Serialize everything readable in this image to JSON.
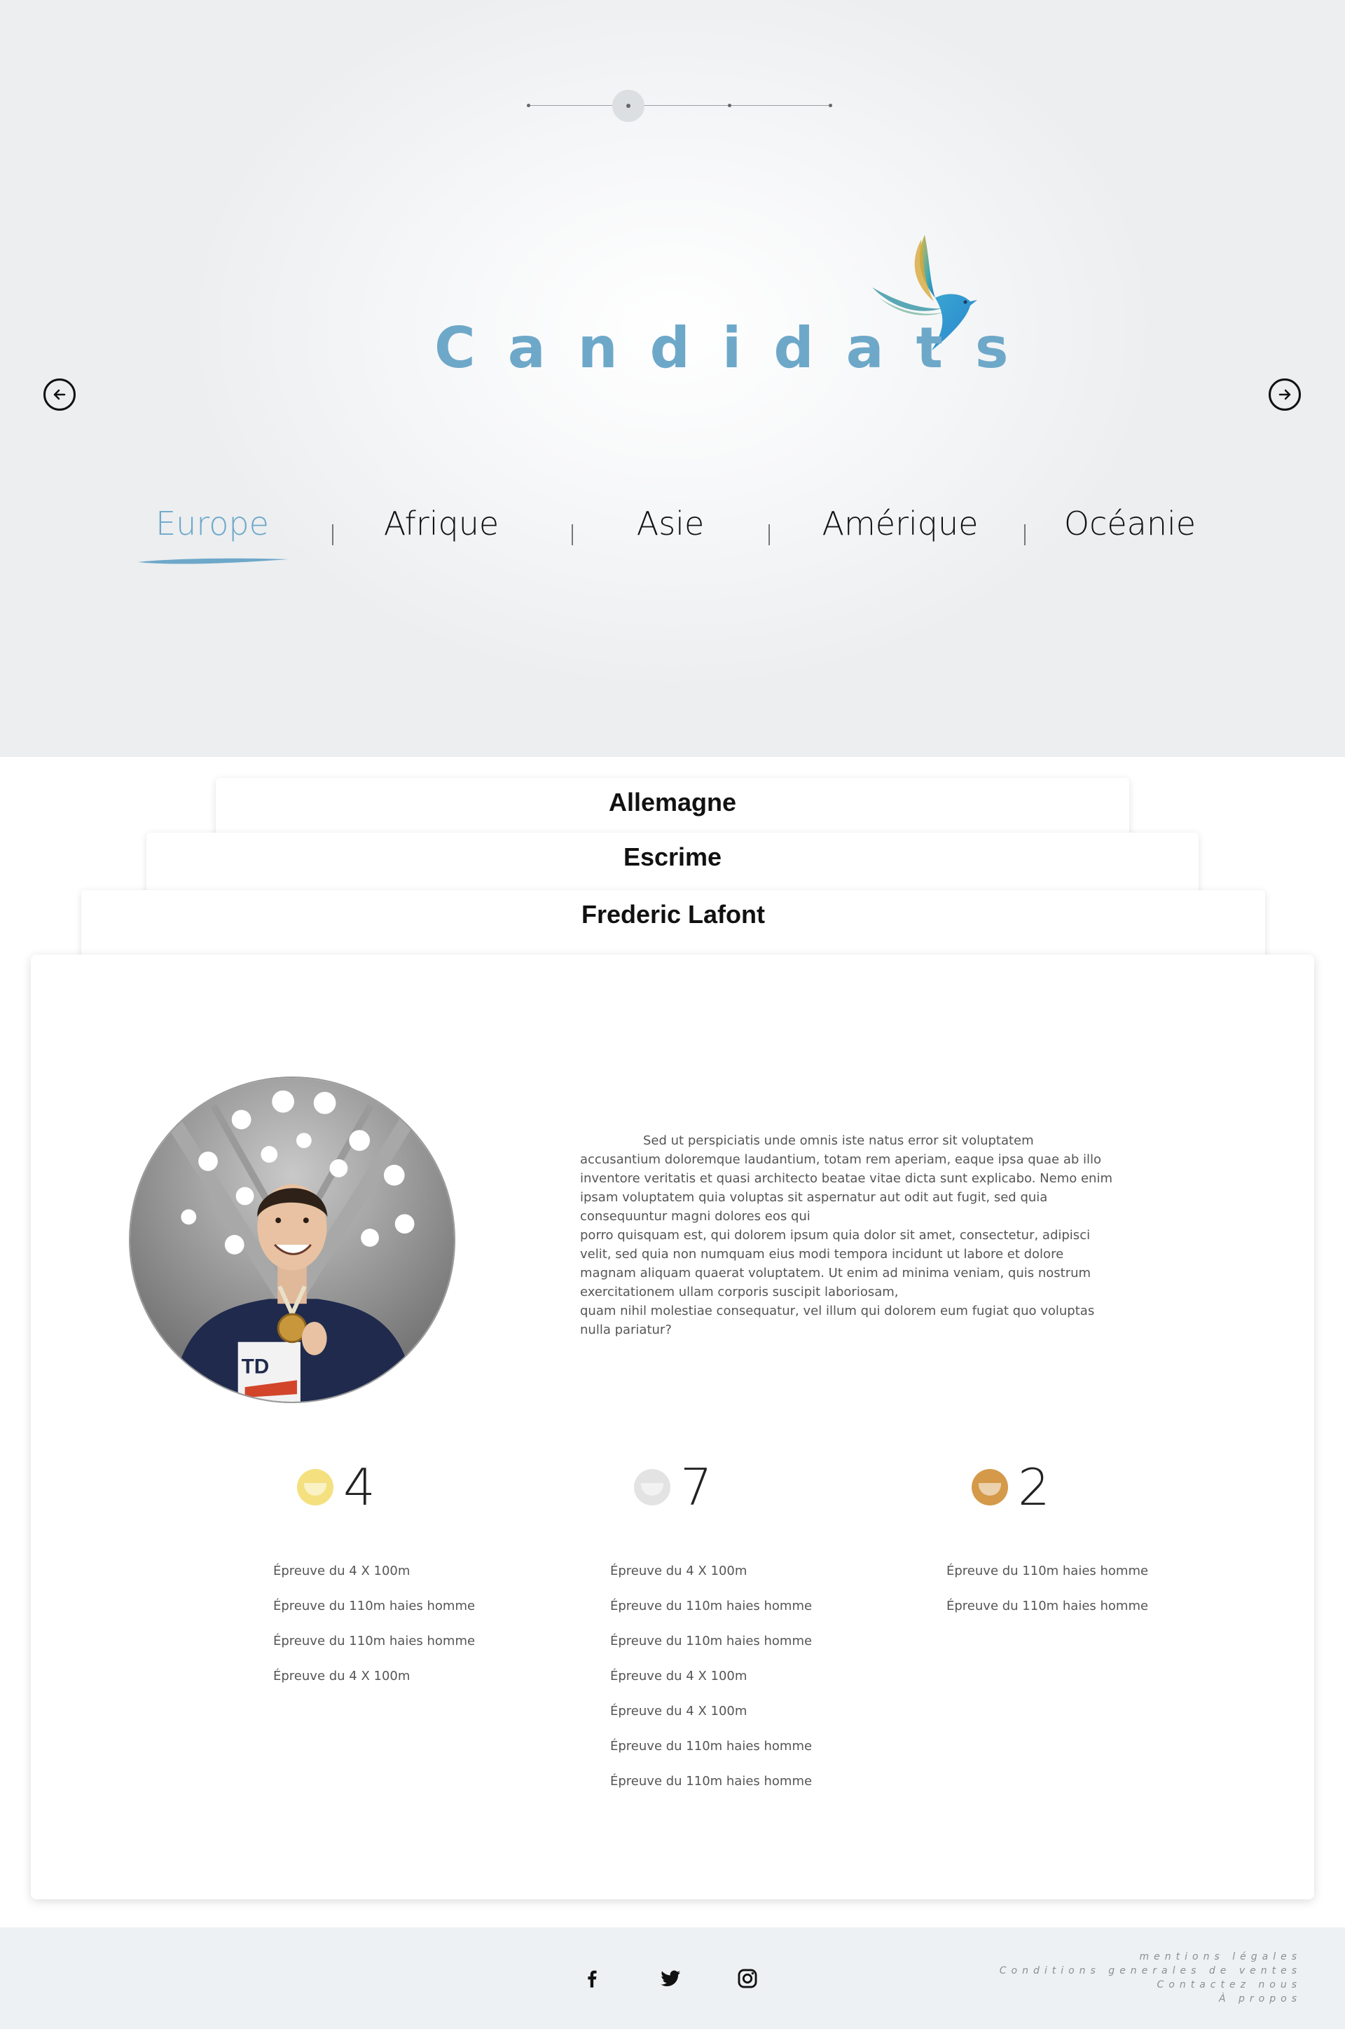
{
  "hero": {
    "title": "Candidats",
    "stepper": {
      "steps": 4,
      "active_step": 2
    },
    "regions": [
      {
        "label": "Europe",
        "active": true
      },
      {
        "label": "Afrique",
        "active": false
      },
      {
        "label": "Asie",
        "active": false
      },
      {
        "label": "Amérique",
        "active": false
      },
      {
        "label": "Océanie",
        "active": false
      }
    ],
    "icons": {
      "prev": "arrow-left-circle-icon",
      "next": "arrow-right-circle-icon",
      "logo": "hummingbird-logo"
    },
    "accent_color": "#6ea8c9"
  },
  "cards": {
    "country": "Allemagne",
    "sport": "Escrime",
    "athlete": "Frederic Lafont"
  },
  "profile": {
    "bio": [
      "Sed ut perspiciatis unde omnis iste natus error sit voluptatem accusantium doloremque laudantium, totam rem aperiam, eaque ipsa quae ab illo inventore veritatis et quasi architecto beatae vitae dicta sunt explicabo. Nemo enim ipsam voluptatem quia voluptas sit aspernatur aut odit aut fugit, sed quia consequuntur magni dolores eos qui",
      "porro quisquam est, qui dolorem ipsum quia dolor sit amet, consectetur, adipisci velit, sed quia non numquam eius modi tempora incidunt ut labore et dolore magnam aliquam quaerat voluptatem. Ut enim ad minima veniam, quis nostrum exercitationem ullam corporis suscipit laboriosam,",
      "quam nihil molestiae consequatur, vel illum qui dolorem eum fugiat quo voluptas nulla pariatur?"
    ]
  },
  "medals": {
    "gold": {
      "count": "4",
      "color": "#f4e07f",
      "events": [
        "Épreuve du 4 X 100m",
        "Épreuve du 110m haies homme",
        "Épreuve du 110m haies homme",
        "Épreuve du 4 X 100m"
      ]
    },
    "silver": {
      "count": "7",
      "color": "#e3e3e3",
      "events": [
        "Épreuve du 4 X 100m",
        "Épreuve du 110m haies homme",
        "Épreuve du 110m haies homme",
        "Épreuve du 4 X 100m",
        "Épreuve du 4 X 100m",
        "Épreuve du 110m haies homme",
        "Épreuve du 110m haies homme"
      ]
    },
    "bronze": {
      "count": "2",
      "color": "#d49a4a",
      "events": [
        "Épreuve du 110m haies homme",
        "Épreuve du 110m haies homme"
      ]
    }
  },
  "footer": {
    "social": [
      "facebook-icon",
      "twitter-icon",
      "instagram-icon"
    ],
    "links": [
      "mentions légales",
      "Conditions generales de ventes",
      "Contactez nous",
      "À propos"
    ]
  }
}
